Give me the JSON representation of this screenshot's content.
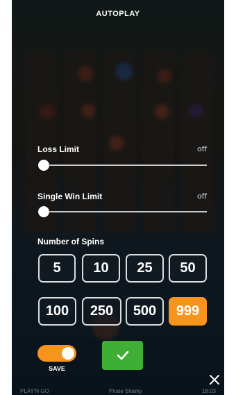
{
  "dialog": {
    "title": "AUTOPLAY"
  },
  "loss_limit": {
    "label": "Loss Limit",
    "value_text": "off",
    "level": 0
  },
  "single_win_limit": {
    "label": "Single Win Limit",
    "value_text": "off",
    "level": 0
  },
  "spins": {
    "label": "Number of Spins",
    "options": [
      "5",
      "10",
      "25",
      "50",
      "100",
      "250",
      "500",
      "999"
    ],
    "selected": "999"
  },
  "save": {
    "label": "SAVE",
    "enabled": true
  },
  "colors": {
    "accent": "#f7941d",
    "confirm": "#3fae34"
  },
  "icons": {
    "confirm": "check-icon",
    "close": "close-icon"
  },
  "footer": {
    "left": "PLAY'N GO",
    "center": "Pirate Sharky",
    "right": "18:03"
  }
}
